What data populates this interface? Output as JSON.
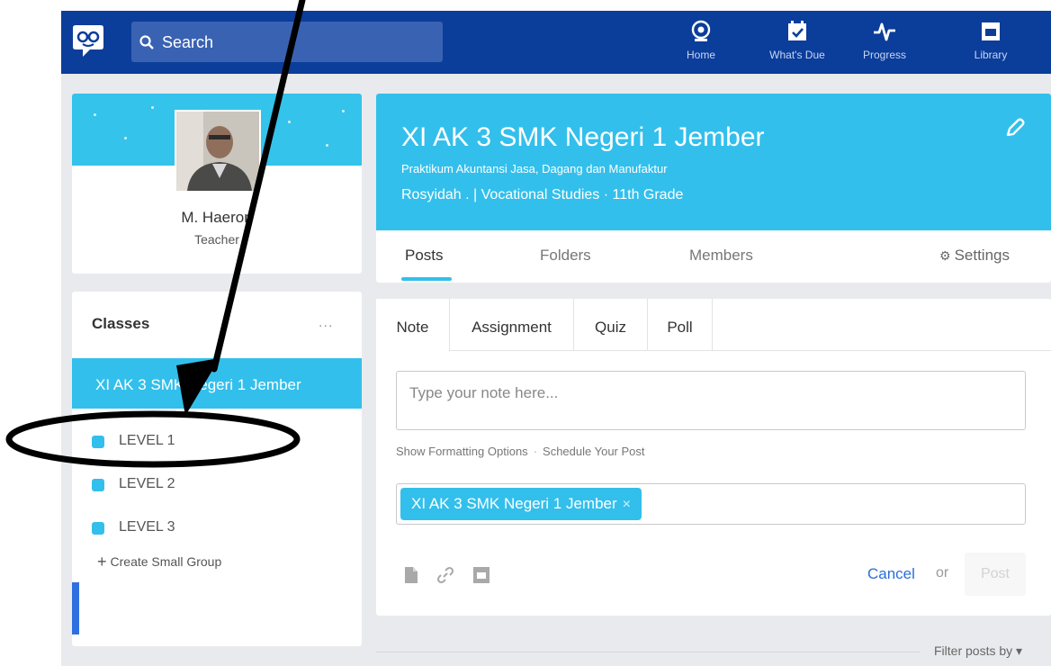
{
  "topbar": {
    "search_placeholder": "Search",
    "nav": [
      {
        "label": "Home",
        "icon": "home-icon"
      },
      {
        "label": "What's Due",
        "icon": "calendar-check-icon"
      },
      {
        "label": "Progress",
        "icon": "pulse-icon"
      },
      {
        "label": "Library",
        "icon": "library-icon"
      }
    ],
    "bar_color": "#0b3d9a"
  },
  "profile": {
    "name": "M. Haeron",
    "role": "Teacher"
  },
  "classes": {
    "title": "Classes",
    "more": "...",
    "active_class": "XI AK 3 SMK Negeri 1 Jember",
    "groups": [
      {
        "label": "LEVEL 1"
      },
      {
        "label": "LEVEL 2"
      },
      {
        "label": "LEVEL 3"
      }
    ],
    "create_group": "Create Small Group"
  },
  "class_header": {
    "title": "XI AK 3 SMK Negeri 1 Jember",
    "subtitle": "Praktikum Akuntansi Jasa, Dagang dan Manufaktur",
    "meta": "Rosyidah . | Vocational Studies  · 11th Grade",
    "tabs": [
      {
        "label": "Posts",
        "active": true
      },
      {
        "label": "Folders",
        "active": false
      },
      {
        "label": "Members",
        "active": false
      }
    ],
    "settings": "Settings",
    "accent_color": "#33bfeb"
  },
  "composer": {
    "tabs": [
      {
        "label": "Note",
        "active": true
      },
      {
        "label": "Assignment",
        "active": false
      },
      {
        "label": "Quiz",
        "active": false
      },
      {
        "label": "Poll",
        "active": false
      }
    ],
    "note_placeholder": "Type your note here...",
    "show_formatting": "Show Formatting Options",
    "format_sep": "·",
    "schedule": "Schedule Your Post",
    "recipient_chip": "XI AK 3 SMK Negeri 1 Jember",
    "chip_remove": "×",
    "cancel": "Cancel",
    "or": "or",
    "post": "Post"
  },
  "feed": {
    "filter": "Filter posts by ▾"
  }
}
